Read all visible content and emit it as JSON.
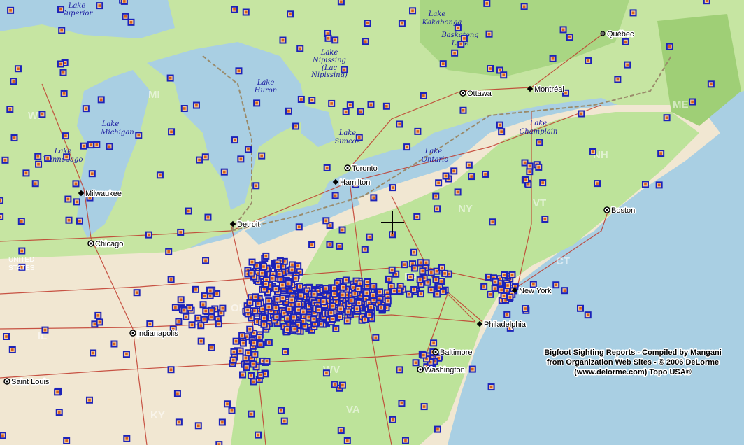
{
  "map": {
    "lakes": [
      {
        "id": "superior",
        "text": "Lake Superior"
      },
      {
        "id": "kakabonga",
        "text": "Lake Kakabonga"
      },
      {
        "id": "baskatong",
        "text": "Baskatong Lake"
      },
      {
        "id": "nipissing",
        "text": "Lake Nipissing (Lac Nipissing)"
      },
      {
        "id": "huron",
        "text": "Lake Huron"
      },
      {
        "id": "michigan",
        "text": "Lake Michigan"
      },
      {
        "id": "winnebago",
        "text": "Lake Winnebago"
      },
      {
        "id": "simcoe",
        "text": "Lake Simcoe"
      },
      {
        "id": "ontario",
        "text": "Lake Ontario"
      },
      {
        "id": "champlain",
        "text": "Lake Champlain"
      }
    ],
    "cities": [
      {
        "id": "quebec",
        "name": "Québec"
      },
      {
        "id": "ottawa",
        "name": "Ottawa"
      },
      {
        "id": "montreal",
        "name": "Montréal"
      },
      {
        "id": "toronto",
        "name": "Toronto"
      },
      {
        "id": "hamilton",
        "name": "Hamilton"
      },
      {
        "id": "milwaukee",
        "name": "Milwaukee"
      },
      {
        "id": "detroit",
        "name": "Detroit"
      },
      {
        "id": "chicago",
        "name": "Chicago"
      },
      {
        "id": "boston",
        "name": "Boston"
      },
      {
        "id": "newyork",
        "name": "New York"
      },
      {
        "id": "philadelphia",
        "name": "Philadelphia"
      },
      {
        "id": "baltimore",
        "name": "Baltimore"
      },
      {
        "id": "washington",
        "name": "Washington"
      },
      {
        "id": "indianapolis",
        "name": "Indianapolis"
      },
      {
        "id": "stlouis",
        "name": "Saint Louis"
      }
    ],
    "states": [
      "MI",
      "WI",
      "IL",
      "IN",
      "KY",
      "WV",
      "VA",
      "NY",
      "PA",
      "OH",
      "NH",
      "ME",
      "VT",
      "CT"
    ],
    "country_label": "UNITED STATES",
    "credit": [
      "Bigfoot Sighting Reports - Compiled by Mangani",
      "from Organization Web Sites - © 2006 DeLorme",
      "(www.delorme.com) Topo USA®"
    ],
    "marker_icon": "sighting-marker-icon",
    "crosshair_icon": "crosshair-icon",
    "colors": {
      "water": "#a9cfe3",
      "canada_land": "#c6e5a2",
      "us_land": "#f0e6cf",
      "forest": "#a6d47a",
      "marker_border": "#1c22b8",
      "marker_fill": "#d8601a",
      "roads": "#c0392b",
      "border": "#9a8a6a"
    }
  }
}
